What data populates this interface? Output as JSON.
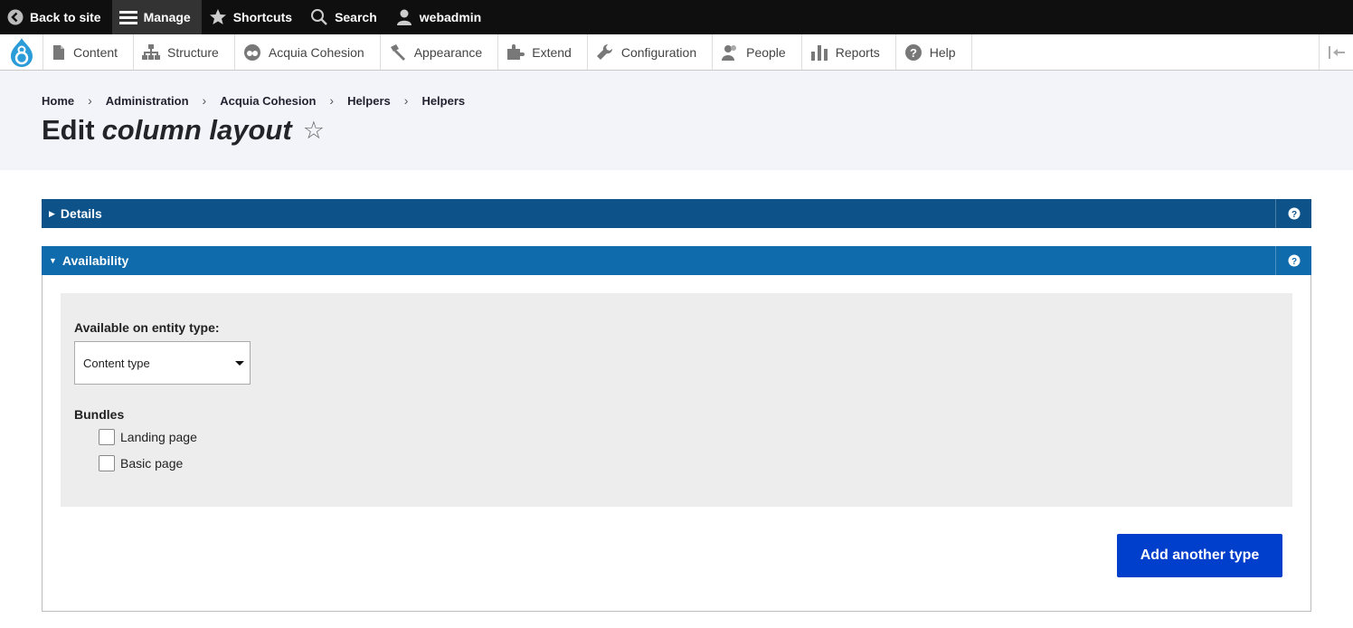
{
  "toolbar": {
    "back_label": "Back to site",
    "manage_label": "Manage",
    "shortcuts_label": "Shortcuts",
    "search_label": "Search",
    "user_label": "webadmin"
  },
  "tray": {
    "items": [
      {
        "label": "Content",
        "icon": "file-icon"
      },
      {
        "label": "Structure",
        "icon": "sitemap-icon"
      },
      {
        "label": "Acquia Cohesion",
        "icon": "cohesion-icon"
      },
      {
        "label": "Appearance",
        "icon": "paintbrush-icon"
      },
      {
        "label": "Extend",
        "icon": "puzzle-icon"
      },
      {
        "label": "Configuration",
        "icon": "wrench-icon"
      },
      {
        "label": "People",
        "icon": "people-icon"
      },
      {
        "label": "Reports",
        "icon": "bar-chart-icon"
      },
      {
        "label": "Help",
        "icon": "help-icon"
      }
    ]
  },
  "breadcrumb": [
    "Home",
    "Administration",
    "Acquia Cohesion",
    "Helpers",
    "Helpers"
  ],
  "page": {
    "title_prefix": "Edit",
    "title_emphasis": "column layout",
    "star_glyph": "☆"
  },
  "details": {
    "label": "Details"
  },
  "availability": {
    "label": "Availability",
    "entity_type_label": "Available on entity type:",
    "entity_type_value": "Content type",
    "bundles_label": "Bundles",
    "bundles": [
      {
        "label": "Landing page",
        "checked": false
      },
      {
        "label": "Basic page",
        "checked": false
      }
    ],
    "add_button": "Add another type"
  },
  "colors": {
    "details_header": "#0d5389",
    "availability_header": "#0f6bab",
    "primary_button": "#003ecc"
  }
}
